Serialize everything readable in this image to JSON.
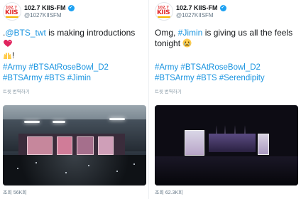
{
  "tweets": [
    {
      "name": "102.7 KIIS-FM",
      "handle": "@1027KIISFM",
      "text_prefix": ".",
      "mention": "@BTS_twt",
      "text_suffix": " is making introductions",
      "hashtags": "#Army #BTSAtRoseBowl_D2 #BTSArmy #BTS #Jimin",
      "translate": "트윗 번역하기",
      "views": "조회 56K회"
    },
    {
      "name": "102.7 KIIS-FM",
      "handle": "@1027KIISFM",
      "text_prefix": "Omg, ",
      "mention": "#Jimin",
      "text_suffix": " is giving us all the feels tonight",
      "hashtags": "#Army #BTSAtRoseBowl_D2 #BTSArmy #BTS #Serendipity",
      "translate": "트윗 번역하기",
      "views": "조회 62.3K회"
    }
  ],
  "logo": {
    "top": "102.7",
    "main": "KIIS"
  },
  "colors": {
    "link": "#1b95e0",
    "verified": "#1da1f2",
    "text": "#14171a",
    "muted": "#657786"
  }
}
